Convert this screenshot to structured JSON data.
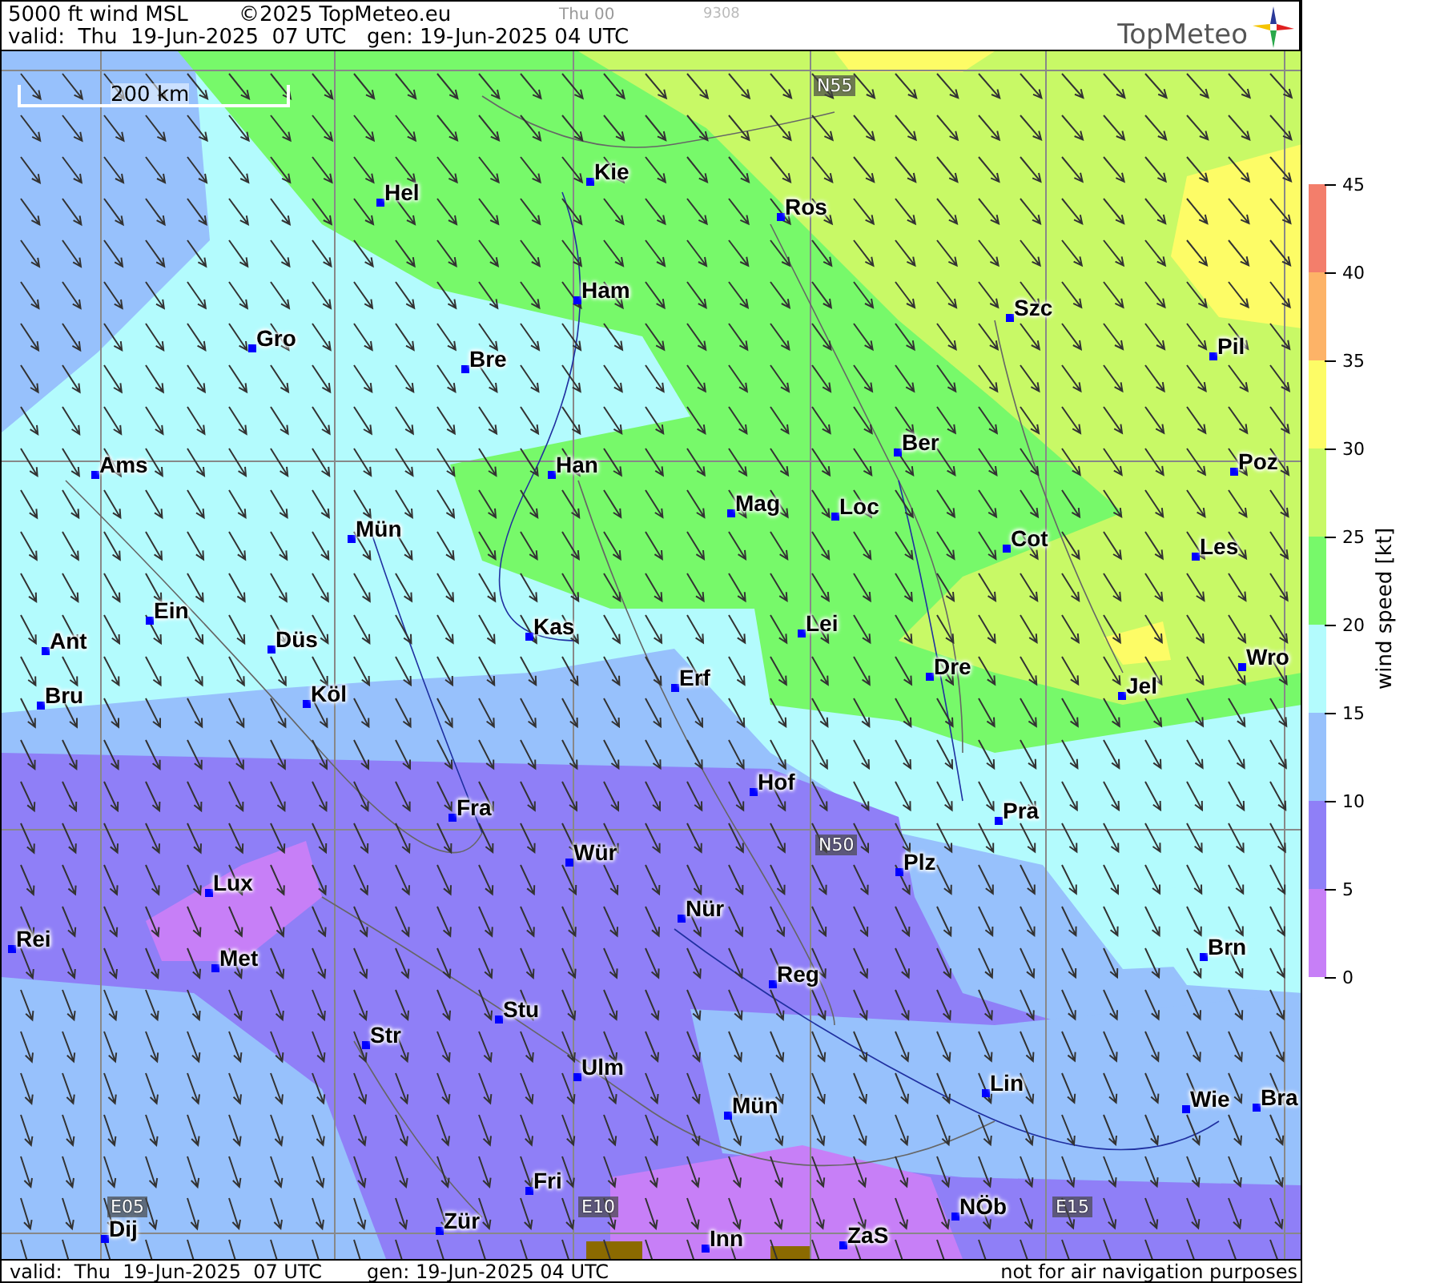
{
  "header": {
    "title": "5000 ft wind MSL",
    "copyright": "©2025 TopMeteo.eu",
    "run": "Thu 00",
    "code": "9308",
    "valid": "valid:  Thu  19-Jun-2025  07 UTC",
    "generated": "gen: 19-Jun-2025 04 UTC",
    "logo": "TopMeteo"
  },
  "map": {
    "scale": "200 km",
    "grid_labels": [
      "N55",
      "N50",
      "E05",
      "E10",
      "E15"
    ],
    "cities": [
      "Hel",
      "Kie",
      "Ros",
      "Ham",
      "Szc",
      "Gro",
      "Bre",
      "Pil",
      "Ber",
      "Ams",
      "Han",
      "Poz",
      "Mag",
      "Loc",
      "Cot",
      "Les",
      "Mün",
      "Ein",
      "Kas",
      "Lei",
      "Ant",
      "Düs",
      "Dre",
      "Wro",
      "Erf",
      "Jel",
      "Bru",
      "Köl",
      "Hof",
      "Fra",
      "Pra",
      "Wür",
      "Plz",
      "Lux",
      "Nür",
      "Rei",
      "Met",
      "Brn",
      "Reg",
      "Stu",
      "Str",
      "Lin",
      "Ulm",
      "Wie",
      "Bra",
      "Mün",
      "Fri",
      "NÖb",
      "Dij",
      "Zür",
      "Inn",
      "ZaS"
    ]
  },
  "legend": {
    "title": "wind speed [kt]",
    "ticks": [
      "45",
      "40",
      "35",
      "30",
      "25",
      "20",
      "15",
      "10",
      "5",
      "0"
    ],
    "bands": [
      {
        "color": "#f37e6b"
      },
      {
        "color": "#fdb367"
      },
      {
        "color": "#fdfc66"
      },
      {
        "color": "#c8f966"
      },
      {
        "color": "#77f96a"
      },
      {
        "color": "#b3fbfd"
      },
      {
        "color": "#97c1fc"
      },
      {
        "color": "#8f7ff7"
      },
      {
        "color": "#c77ff7"
      }
    ]
  },
  "footer": {
    "valid": "valid:  Thu  19-Jun-2025  07 UTC",
    "generated": "gen: 19-Jun-2025 04 UTC",
    "notice": "not for air navigation purposes"
  }
}
